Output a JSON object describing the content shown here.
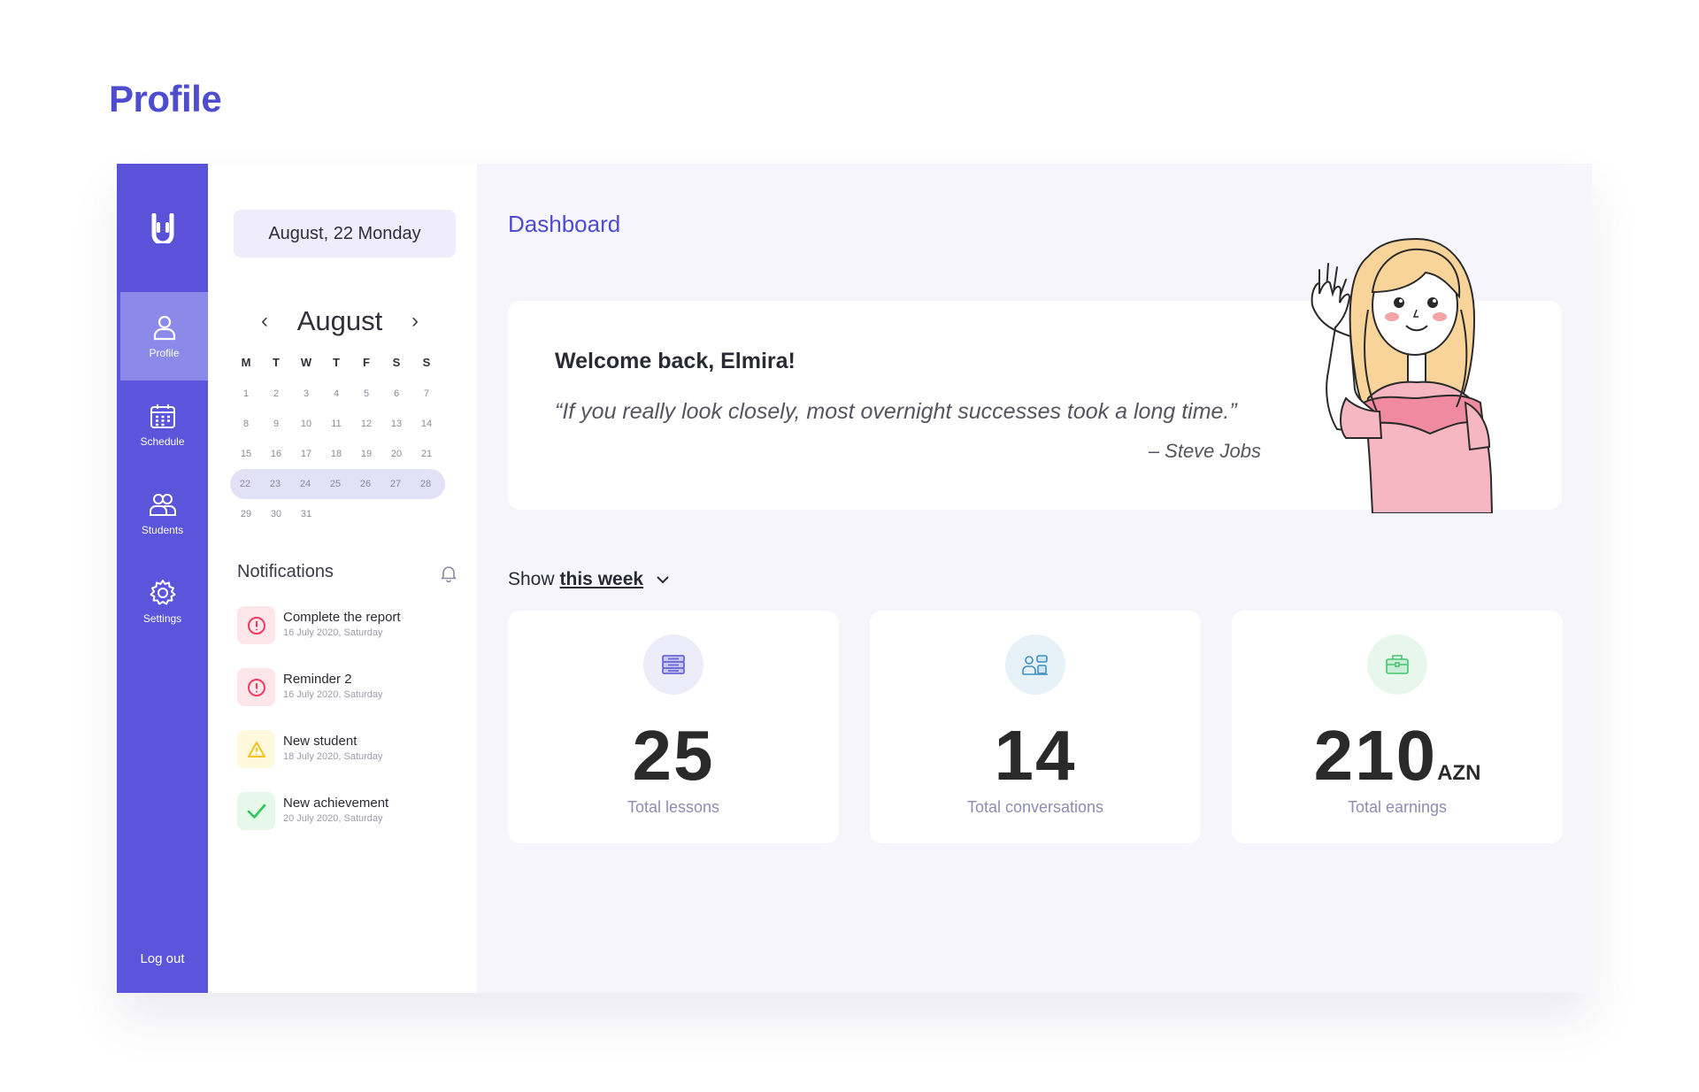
{
  "page": {
    "heading": "Profile"
  },
  "sidebar": {
    "items": [
      {
        "label": "Profile",
        "icon": "user-icon"
      },
      {
        "label": "Schedule",
        "icon": "calendar-icon"
      },
      {
        "label": "Students",
        "icon": "users-icon"
      },
      {
        "label": "Settings",
        "icon": "gear-icon"
      }
    ],
    "active": "Profile",
    "logout_label": "Log out"
  },
  "calendar": {
    "current_date": "August, 22 Monday",
    "month": "August",
    "prev_icon": "chevron-left-icon",
    "next_icon": "chevron-right-icon",
    "weekdays": [
      "M",
      "T",
      "W",
      "T",
      "F",
      "S",
      "S"
    ],
    "weeks": [
      [
        "1",
        "2",
        "3",
        "4",
        "5",
        "6",
        "7"
      ],
      [
        "8",
        "9",
        "10",
        "11",
        "12",
        "13",
        "14"
      ],
      [
        "15",
        "16",
        "17",
        "18",
        "19",
        "20",
        "21"
      ],
      [
        "22",
        "23",
        "24",
        "25",
        "26",
        "27",
        "28"
      ],
      [
        "29",
        "30",
        "31"
      ]
    ],
    "highlighted_week": 3
  },
  "notifications": {
    "title": "Notifications",
    "items": [
      {
        "title": "Complete the report",
        "date": "16 July 2020, Saturday",
        "type": "error",
        "icon": "alert-circle-icon"
      },
      {
        "title": "Reminder 2",
        "date": "16 July 2020, Saturday",
        "type": "error",
        "icon": "alert-circle-icon"
      },
      {
        "title": "New student",
        "date": "18 July 2020, Saturday",
        "type": "warning",
        "icon": "warning-triangle-icon"
      },
      {
        "title": "New achievement",
        "date": "20 July 2020, Saturday",
        "type": "success",
        "icon": "check-icon"
      }
    ]
  },
  "dashboard": {
    "title": "Dashboard",
    "welcome": "Welcome back, Elmira!",
    "quote": "“If you really look closely, most overnight successes took a long time.”",
    "author": "– Steve Jobs",
    "filter": {
      "prefix": "Show",
      "value": "this week"
    },
    "stats": [
      {
        "value": "25",
        "unit": "",
        "label": "Total lessons",
        "icon": "lessons-icon",
        "icon_bg": "#ececf8"
      },
      {
        "value": "14",
        "unit": "",
        "label": "Total conversations",
        "icon": "conversations-icon",
        "icon_bg": "#e7f1f8"
      },
      {
        "value": "210",
        "unit": "AZN",
        "label": "Total earnings",
        "icon": "wallet-icon",
        "icon_bg": "#e8f7ec"
      }
    ]
  },
  "colors": {
    "primary": "#5b55dc",
    "accent_text": "#4e4ccf",
    "background": "#f5f5fb",
    "error": "#f03a5f",
    "warning": "#f3c31c",
    "success": "#2fc65a"
  }
}
